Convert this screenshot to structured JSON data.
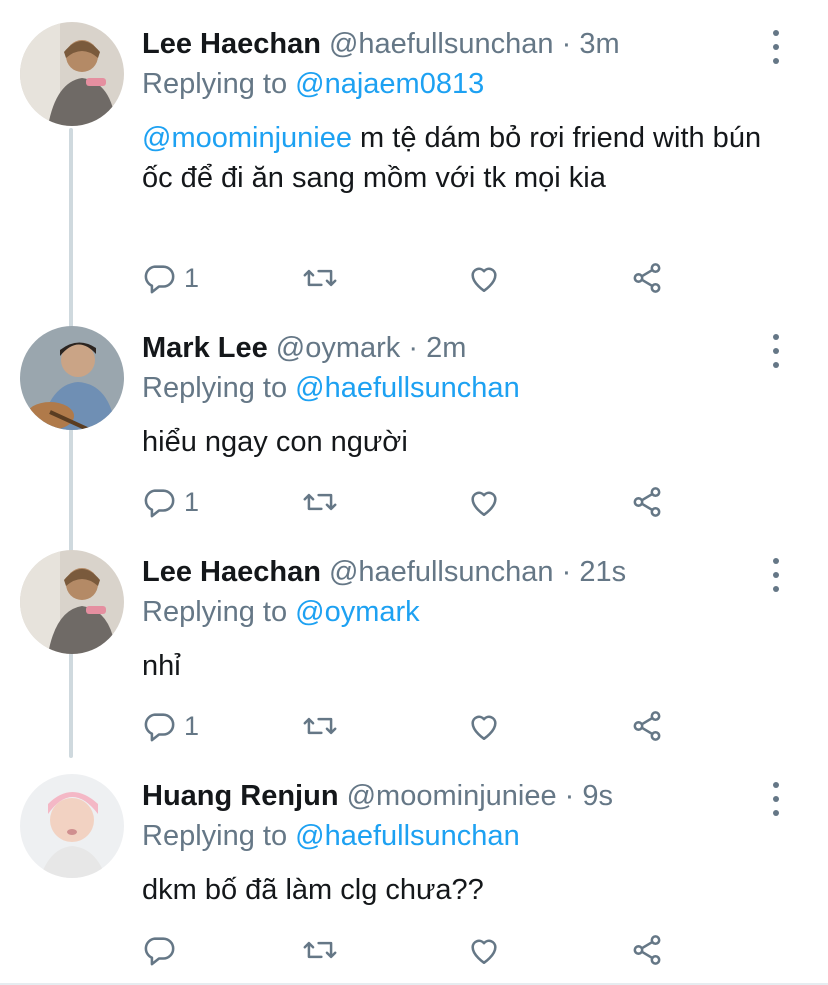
{
  "tweets": [
    {
      "name": "Lee Haechan",
      "handle": "@haefullsunchan",
      "sep": "·",
      "time": "3m",
      "replying_prefix": "Replying to ",
      "replying_to": "@najaem0813",
      "mention": "@moominjuniee",
      "text": " m tệ dám bỏ rơi friend with bún ốc để đi ăn sang mồm với tk mọi kia",
      "reply_count": "1"
    },
    {
      "name": "Mark Lee",
      "handle": "@oymark",
      "sep": "·",
      "time": "2m",
      "replying_prefix": "Replying to ",
      "replying_to": "@haefullsunchan",
      "mention": "",
      "text": "hiểu ngay con người",
      "reply_count": "1"
    },
    {
      "name": "Lee Haechan",
      "handle": "@haefullsunchan",
      "sep": "·",
      "time": "21s",
      "replying_prefix": "Replying to ",
      "replying_to": "@oymark",
      "mention": "",
      "text": "nhỉ",
      "reply_count": "1"
    },
    {
      "name": "Huang Renjun",
      "handle": "@moominjuniee",
      "sep": "·",
      "time": "9s",
      "replying_prefix": "Replying to ",
      "replying_to": "@haefullsunchan",
      "mention": "",
      "text": "dkm bố đã làm clg chưa??",
      "reply_count": ""
    }
  ],
  "icons": {
    "reply": "reply-icon",
    "retweet": "retweet-icon",
    "like": "heart-icon",
    "share": "share-icon",
    "more": "more-vertical-icon"
  },
  "colors": {
    "name": "#14171a",
    "secondary": "#657786",
    "mention": "#1da1f2",
    "thread_line": "#cfd9de"
  }
}
